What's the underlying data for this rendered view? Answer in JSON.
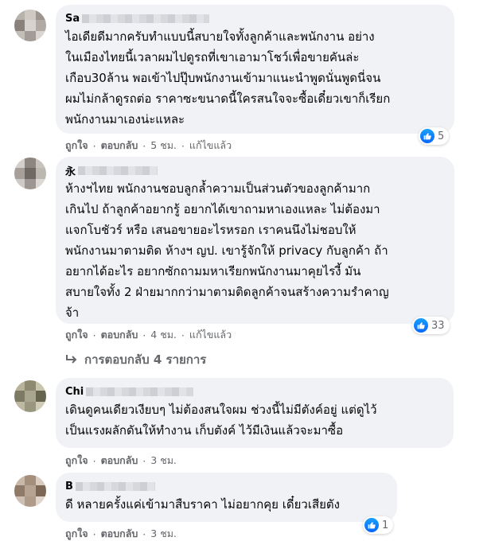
{
  "actions": {
    "like": "ถูกใจ",
    "reply": "ตอบกลับ",
    "edited": "แก้ไขแล้ว",
    "dot": "·"
  },
  "colors": {
    "bubble": "#f0f2f5",
    "like_blue": "#0866ff",
    "meta_grey": "#65676b"
  },
  "comments": [
    {
      "author": "Sa",
      "text": "ไอเดียดีมากครับทำแบบนี้สบายใจทั้งลูกค้าและพนักงาน อย่าง\nในเมืองไทยนี้เวลาผมไปดูรถที่เขาเอามาโชว์เพื่อขายคันล่ะ\nเกือบ30ล้าน พอเข้าไปปุ๊บพนักงานเข้ามาแนะนำพูดนั่นพูดนี่จน\nผมไม่กล้าดูรถต่อ ราคาซะขนาดนี้ใครสนใจจะซื้อเดี๋ยวเขาก็เรียก\nพนักงานมาเองน่ะแหละ",
      "time": "5 ชม.",
      "reactions": "5",
      "avatar_icon": "avatar-icon"
    },
    {
      "author": "永",
      "text": "ห้างฯไทย พนักงานชอบลูกล้ำความเป็นส่วนตัวของลูกค้ามาก\nเกินไป ถ้าลูกค้าอยากรู้ อยากได้เขาถามหาเองแหละ ไม่ต้องมา\nแจกโบชัวร์ หรือ เสนอขายอะไรหรอก เราคนนึงไม่ชอบให้\nพนักงานมาตามติด ห้างฯ ญป. เขารู้จักให้ privacy กับลูกค้า ถ้า\nอยากได้อะไร อยากซักถามมหาเรียกพนักงานมาคุยไรงี้ มัน\nสบายใจทั้ง 2 ฝ่ายมากกว่ามาตามติดลูกค้าจนสร้างความรำคาญ\nจ้า",
      "time": "4 ชม.",
      "reactions": "33",
      "replies_label": "การตอบกลับ 4 รายการ"
    },
    {
      "author": "Chi",
      "text": "เดินดูคนเดียวเงียบๆ ไม่ต้องสนใจผม ช่วงนี้ไม่มีตังค์อยู่ แต่ดูไว้\nเป็นแรงผลักดันให้ทำงาน เก็บตังค์ ไว้มีเงินแล้วจะมาซื้อ",
      "time": "3 ชม."
    },
    {
      "author": "B",
      "text": "ดี หลายครั้งแค่เข้ามาสืบราคา ไม่อยากคุย เดี๋ยวเสียตัง",
      "time": "3 ชม.",
      "reactions": "1"
    }
  ]
}
